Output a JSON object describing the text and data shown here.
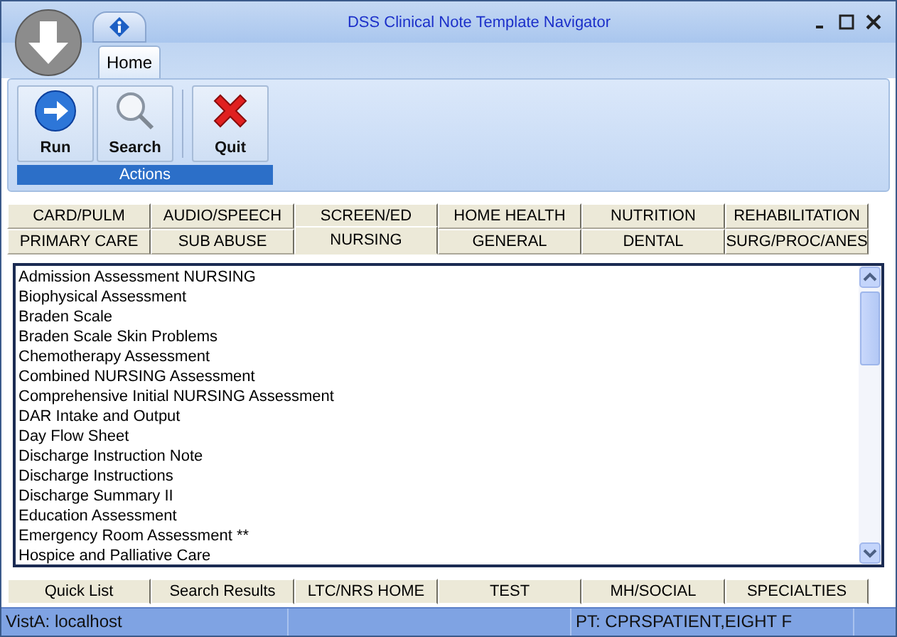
{
  "window": {
    "title": "DSS Clinical Note Template Navigator"
  },
  "ribbon_tabs": [
    {
      "label": "Home",
      "selected": true
    }
  ],
  "ribbon_groups": [
    {
      "label": "Actions",
      "buttons": [
        {
          "kind": "run",
          "label": "Run"
        },
        {
          "kind": "search",
          "label": "Search"
        },
        {
          "kind": "quit",
          "label": "Quit"
        }
      ]
    }
  ],
  "category_tabs": [
    [
      {
        "label": "CARD/PULM",
        "selected": false
      },
      {
        "label": "AUDIO/SPEECH",
        "selected": false
      },
      {
        "label": "SCREEN/ED",
        "selected": false
      },
      {
        "label": "HOME HEALTH",
        "selected": false
      },
      {
        "label": "NUTRITION",
        "selected": false
      },
      {
        "label": "REHABILITATION",
        "selected": false
      }
    ],
    [
      {
        "label": "PRIMARY CARE",
        "selected": false
      },
      {
        "label": "SUB ABUSE",
        "selected": false
      },
      {
        "label": "NURSING",
        "selected": true
      },
      {
        "label": "GENERAL",
        "selected": false
      },
      {
        "label": "DENTAL",
        "selected": false
      },
      {
        "label": "SURG/PROC/ANES",
        "selected": false
      }
    ]
  ],
  "templates": [
    "Admission Assessment NURSING",
    "Biophysical Assessment",
    "Braden Scale",
    "Braden Scale Skin Problems",
    "Chemotherapy Assessment",
    "Combined NURSING Assessment",
    "Comprehensive Initial NURSING Assessment",
    "DAR Intake and Output",
    "Day Flow Sheet",
    "Discharge Instruction Note",
    "Discharge Instructions",
    "Discharge Summary II",
    "Education Assessment",
    "Emergency Room Assessment **",
    "Hospice and Palliative Care"
  ],
  "bottom_tabs": [
    {
      "label": "Quick List"
    },
    {
      "label": "Search Results"
    },
    {
      "label": "LTC/NRS HOME"
    },
    {
      "label": "TEST"
    },
    {
      "label": "MH/SOCIAL"
    },
    {
      "label": "SPECIALTIES"
    }
  ],
  "status_bar": {
    "server": "VistA: localhost",
    "patient": "PT: CPRSPATIENT,EIGHT F"
  }
}
